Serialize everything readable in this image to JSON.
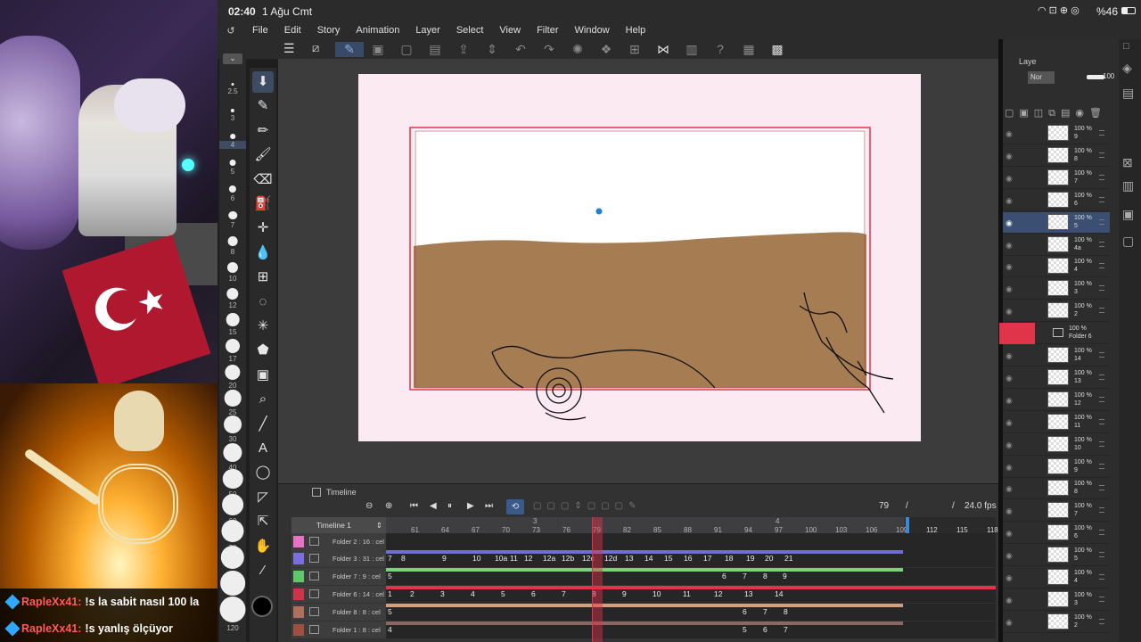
{
  "status_bar": {
    "time": "02:40",
    "date": "1 Ağu Cmt",
    "battery": "%46"
  },
  "menu": [
    "File",
    "Edit",
    "Story",
    "Animation",
    "Layer",
    "Select",
    "View",
    "Filter",
    "Window",
    "Help"
  ],
  "brush_sizes": [
    "2.5",
    "3",
    "4",
    "5",
    "6",
    "7",
    "8",
    "10",
    "12",
    "15",
    "17",
    "20",
    "25",
    "30",
    "40",
    "50",
    "60",
    "70",
    "80",
    "100",
    "120"
  ],
  "chat": [
    {
      "user": "RapleXx41:",
      "message": "!s la sabit nasıl 100 la"
    },
    {
      "user": "RapleXx41:",
      "message": "!s yanlış ölçüyor"
    }
  ],
  "timeline": {
    "panel_title": "Timeline",
    "name": "Timeline 1",
    "current_frame": "79",
    "fps": "24.0 fps",
    "ruler_ticks": [
      "61",
      "64",
      "67",
      "70",
      "73",
      "76",
      "79",
      "82",
      "85",
      "88",
      "91",
      "94",
      "97",
      "100",
      "103",
      "106",
      "109",
      "112",
      "115",
      "118"
    ],
    "ruler_markers": [
      {
        "label": "3"
      },
      {
        "label": "4"
      }
    ],
    "rows": [
      {
        "name": "Folder 2 : 16 : cel",
        "cells": []
      },
      {
        "name": "Folder 3 : 31 : cel",
        "cells": [
          "7",
          "8",
          "9",
          "10",
          "10a",
          "11",
          "12",
          "12a",
          "12b",
          "12c",
          "12d",
          "13",
          "14",
          "15",
          "16",
          "17",
          "18",
          "19",
          "20",
          "21"
        ]
      },
      {
        "name": "Folder 7 : 9 : cel",
        "cells": [
          "5",
          "6",
          "7",
          "8",
          "9"
        ]
      },
      {
        "name": "Folder 6 : 14 : cel",
        "cells": [
          "1",
          "2",
          "3",
          "4",
          "5",
          "6",
          "7",
          "8",
          "9",
          "10",
          "11",
          "12",
          "13",
          "14"
        ]
      },
      {
        "name": "Folder 8 : 8 : cel",
        "cells": [
          "5",
          "6",
          "7",
          "8"
        ]
      },
      {
        "name": "Folder 1 : 8 : cel",
        "cells": [
          "4",
          "5",
          "6",
          "7"
        ]
      }
    ]
  },
  "layers_panel": {
    "tab": "Laye",
    "blend": "Nor",
    "opacity": "100",
    "folder": {
      "opacity": "100 %",
      "name": "Folder 6"
    },
    "layers_top": [
      {
        "opacity": "100 %",
        "name": "9"
      },
      {
        "opacity": "100 %",
        "name": "8"
      },
      {
        "opacity": "100 %",
        "name": "7"
      },
      {
        "opacity": "100 %",
        "name": "6"
      },
      {
        "opacity": "100 %",
        "name": "5"
      },
      {
        "opacity": "100 %",
        "name": "4a"
      },
      {
        "opacity": "100 %",
        "name": "4"
      },
      {
        "opacity": "100 %",
        "name": "3"
      },
      {
        "opacity": "100 %",
        "name": "2"
      }
    ],
    "layers_folder": [
      {
        "opacity": "100 %",
        "name": "14"
      },
      {
        "opacity": "100 %",
        "name": "13"
      },
      {
        "opacity": "100 %",
        "name": "12"
      },
      {
        "opacity": "100 %",
        "name": "11"
      },
      {
        "opacity": "100 %",
        "name": "10"
      },
      {
        "opacity": "100 %",
        "name": "9"
      },
      {
        "opacity": "100 %",
        "name": "8"
      },
      {
        "opacity": "100 %",
        "name": "7"
      },
      {
        "opacity": "100 %",
        "name": "6"
      },
      {
        "opacity": "100 %",
        "name": "5"
      },
      {
        "opacity": "100 %",
        "name": "4"
      },
      {
        "opacity": "100 %",
        "name": "3"
      },
      {
        "opacity": "100 %",
        "name": "2"
      }
    ]
  },
  "colors": {
    "accent_red": "#e0344a",
    "ground": "#a67c52",
    "sky": "#ffffff",
    "canvas_bg": "#fbeaf1",
    "selected_blue": "#3a6ea5"
  }
}
